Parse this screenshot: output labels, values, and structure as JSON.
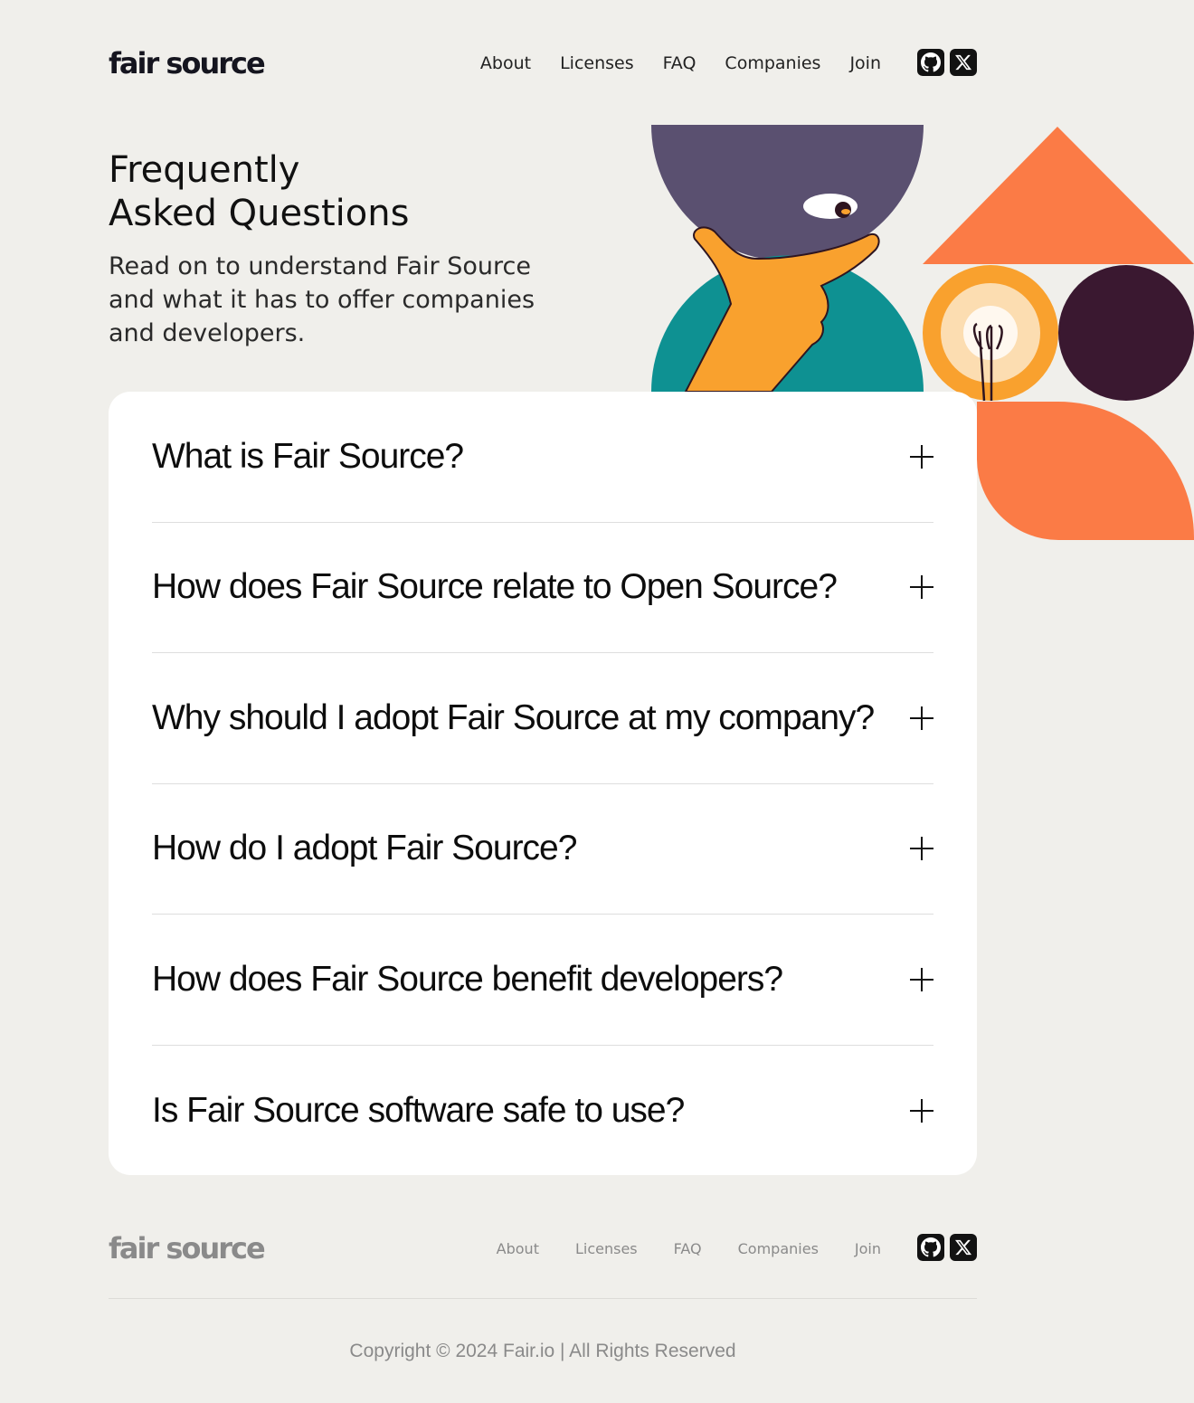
{
  "header": {
    "logo": "fair source",
    "nav": [
      "About",
      "Licenses",
      "FAQ",
      "Companies",
      "Join"
    ],
    "socials": [
      {
        "icon": "github-icon",
        "glyph": "◉"
      },
      {
        "icon": "x-icon",
        "glyph": "𝕏"
      }
    ]
  },
  "hero": {
    "title_line1": "Frequently",
    "title_line2": "Asked Questions",
    "subtitle": "Read on to understand Fair Source and what it has to offer companies and developers."
  },
  "faq": {
    "items": [
      "What is Fair Source?",
      "How does Fair Source relate to Open Source?",
      "Why should I adopt Fair Source at my company?",
      "How do I adopt Fair Source?",
      "How does Fair Source benefit developers?",
      "Is Fair Source software safe to use?"
    ]
  },
  "footer": {
    "logo": "fair source",
    "nav": [
      "About",
      "Licenses",
      "FAQ",
      "Companies",
      "Join"
    ],
    "copyright": "Copyright © 2024 Fair.io | All Rights Reserved"
  },
  "colors": {
    "background": "#f0efeb",
    "purple": "#5a5070",
    "teal": "#0e9192",
    "orange": "#fb7b46",
    "yellow": "#f9a12e",
    "dark_plum": "#3a1830"
  }
}
